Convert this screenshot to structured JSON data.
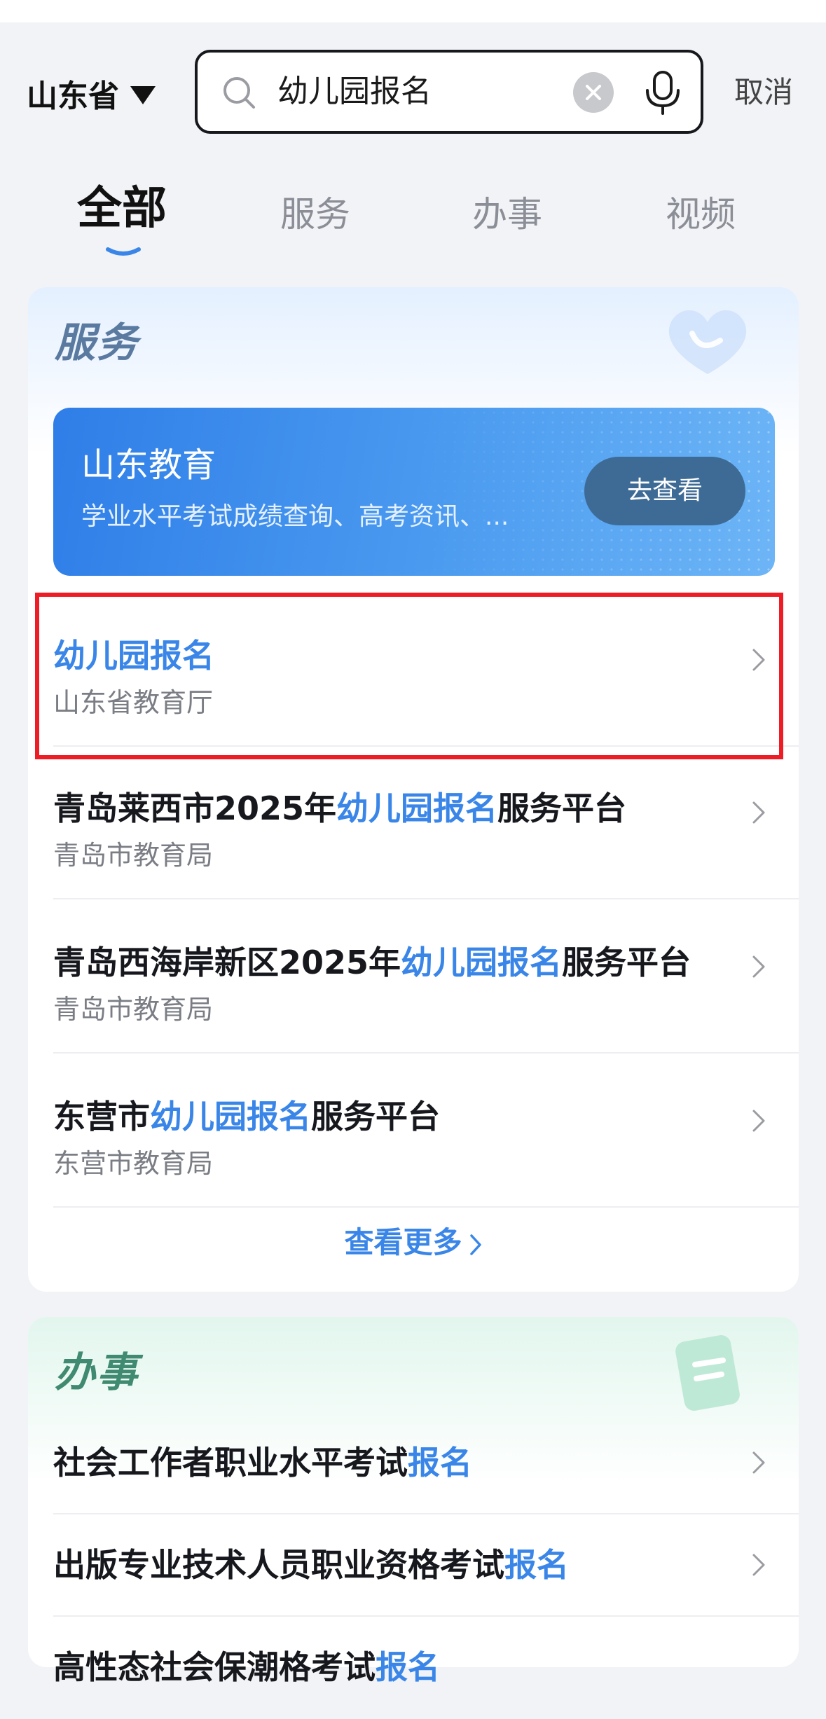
{
  "header": {
    "region": "山东省",
    "search_query": "幼儿园报名",
    "cancel": "取消"
  },
  "tabs": [
    "全部",
    "服务",
    "办事",
    "视频"
  ],
  "services": {
    "title": "服务",
    "banner": {
      "title": "山东教育",
      "subtitle": "学业水平考试成绩查询、高考资讯、...",
      "button": "去查看"
    },
    "items": [
      {
        "title": "幼儿园报名",
        "subtitle": "山东省教育厅"
      },
      {
        "pre": "青岛莱西市2025年",
        "hl": "幼儿园报名",
        "post": "服务平台",
        "subtitle": "青岛市教育局"
      },
      {
        "pre": "青岛西海岸新区2025年",
        "hl": "幼儿园报名",
        "post": "服务平台",
        "subtitle": "青岛市教育局"
      },
      {
        "pre": "东营市",
        "hl": "幼儿园报名",
        "post": "服务平台",
        "subtitle": "东营市教育局"
      }
    ],
    "more": "查看更多"
  },
  "affairs": {
    "title": "办事",
    "items": [
      {
        "pre": "社会工作者职业水平考试",
        "hl": "报名"
      },
      {
        "pre": "出版专业技术人员职业资格考试",
        "hl": "报名"
      },
      {
        "pre": "高性态社会保潮格考试",
        "hl": "报名"
      }
    ]
  },
  "colors": {
    "accent": "#3a86e8",
    "highlight_border": "#ee1c25",
    "background": "#f2f3f7"
  }
}
